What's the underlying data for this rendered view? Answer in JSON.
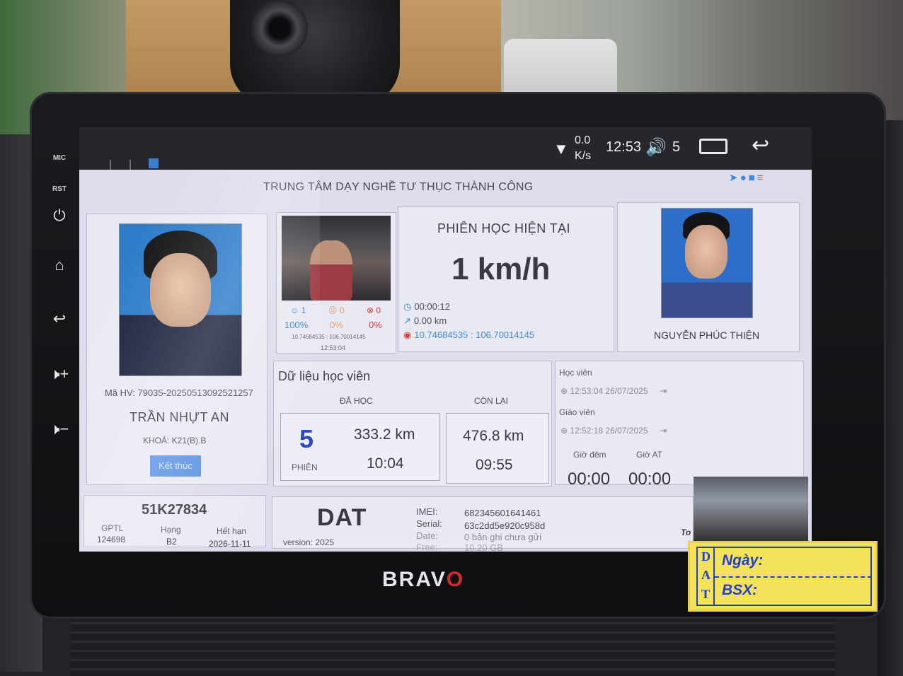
{
  "bezel": {
    "mic_label": "MIC",
    "rst_label": "RST",
    "brand": "BRAV",
    "brand_accent": "O"
  },
  "status_bar": {
    "net_speed_value": "0.0",
    "net_speed_unit": "K/s",
    "time": "12:53",
    "volume": "5"
  },
  "app": {
    "title": "TRUNG TÂM DẠY NGHỀ TƯ THỤC THÀNH CÔNG",
    "student": {
      "id_label": "Mã HV:",
      "id": "79035-20250513092521257",
      "name": "TRẦN NHỰT AN",
      "course": "KHOÁ: K21(B).B",
      "end_button": "Kết thúc"
    },
    "cabin_camera": {
      "stat1": "1",
      "stat2": "0",
      "stat3": "0",
      "pct1": "100%",
      "pct2": "0%",
      "pct3": "0%",
      "coords": "10.74684535 : 106.70014145",
      "time": "12:53:04"
    },
    "session": {
      "title": "PHIÊN HỌC HIỆN TẠI",
      "speed": "1 km/h",
      "duration": "00:00:12",
      "distance": "0.00 km",
      "gps": "10.74684535 : 106.70014145"
    },
    "instructor": {
      "name": "NGUYỄN PHÚC THIỆN"
    },
    "learner_data": {
      "title": "Dữ liệu học viên",
      "done_header": "ĐÃ HỌC",
      "remaining_header": "CÒN LẠI",
      "sessions": "5",
      "sessions_label": "PHIÊN",
      "done_distance": "333.2 km",
      "done_time": "10:04",
      "remaining_distance": "476.8 km",
      "remaining_time": "09:55"
    },
    "log": {
      "student_label": "Học viên",
      "student_time": "12:53:04 26/07/2025",
      "teacher_label": "Giáo viên",
      "teacher_time": "12:52:18 26/07/2025",
      "night_label": "Giờ đêm",
      "auto_label": "Giờ AT",
      "night_value": "00:00",
      "auto_value": "00:00"
    },
    "vehicle": {
      "plate": "51K27834",
      "gptl_label": "GPTL",
      "gptl_value": "124698",
      "class_label": "Hạng",
      "class_value": "B2",
      "expiry_label": "Hết hạn",
      "expiry_value": "2026-11-11"
    },
    "device": {
      "logo": "DAT",
      "version": "version: 2025",
      "imei_label": "IMEI:",
      "imei_value": "682345601641461",
      "serial_label": "Serial:",
      "serial_value": "63c2dd5e920c958d",
      "date_label": "Date:",
      "date_value": "0 bản ghi chưa gửi",
      "free_label": "Free:",
      "free_value": "10.20 GB"
    },
    "road_camera_label": "To"
  },
  "sticker": {
    "letters": [
      "D",
      "A",
      "T"
    ],
    "date_label": "Ngày:",
    "plate_label": "BSX:"
  },
  "colors": {
    "accent_blue": "#3c8ae0",
    "session_count_blue": "#2f49b9",
    "gps_red": "#d83a3a",
    "sticker_yellow": "#f3e25a",
    "sticker_ink": "#2240c8"
  }
}
